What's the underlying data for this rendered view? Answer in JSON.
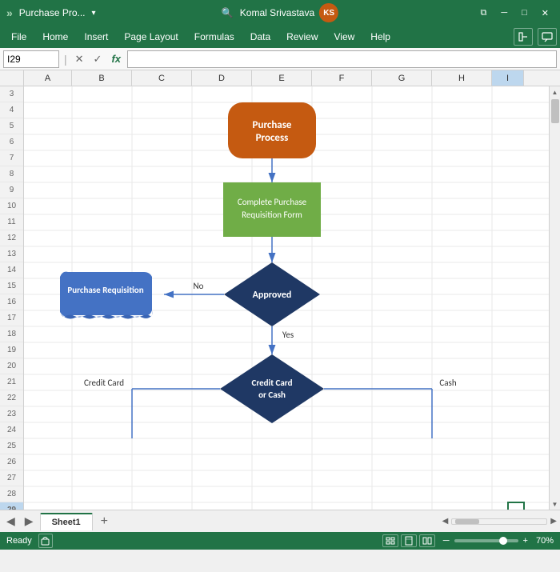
{
  "titleBar": {
    "logo": "»",
    "title": "Purchase Pro...",
    "chevron": "▾",
    "searchPlaceholder": "Search",
    "userName": "Komal Srivastava",
    "userInitials": "KS",
    "windowControls": [
      "⧉",
      "─",
      "□",
      "✕"
    ]
  },
  "menuBar": {
    "items": [
      "File",
      "Home",
      "Insert",
      "Page Layout",
      "Formulas",
      "Data",
      "Review",
      "View",
      "Help"
    ]
  },
  "formulaBar": {
    "nameBox": "I29",
    "cancelIcon": "✕",
    "acceptIcon": "✓",
    "functionIcon": "fx",
    "formula": ""
  },
  "columns": {
    "headers": [
      "A",
      "B",
      "C",
      "D",
      "E",
      "F",
      "G",
      "H",
      "I"
    ],
    "widths": [
      60,
      75,
      75,
      75,
      75,
      75,
      75,
      75,
      40
    ]
  },
  "rows": {
    "count": 27,
    "start": 3
  },
  "flowchart": {
    "startBox": {
      "label": "Purchase\nProcess",
      "type": "rounded",
      "color": "#c55a11",
      "textColor": "#ffffff"
    },
    "processBox": {
      "label": "Complete Purchase\nRequisition Form",
      "type": "rectangle",
      "color": "#70ad47",
      "textColor": "#ffffff"
    },
    "decision1": {
      "label": "Approved",
      "type": "diamond",
      "color": "#1f3864",
      "textColor": "#ffffff",
      "noLabel": "No",
      "yesLabel": "Yes"
    },
    "sideBox": {
      "label": "Purchase Requisition",
      "type": "wave",
      "color": "#4472c4",
      "textColor": "#ffffff"
    },
    "decision2": {
      "label": "Credit Card\nor Cash",
      "type": "diamond",
      "color": "#1f3864",
      "textColor": "#ffffff",
      "leftLabel": "Credit Card",
      "rightLabel": "Cash"
    }
  },
  "sheetTabs": {
    "tabs": [
      "Sheet1"
    ],
    "activeTab": "Sheet1"
  },
  "statusBar": {
    "status": "Ready",
    "zoom": "70%",
    "viewIcons": [
      "grid",
      "page",
      "custom"
    ]
  }
}
